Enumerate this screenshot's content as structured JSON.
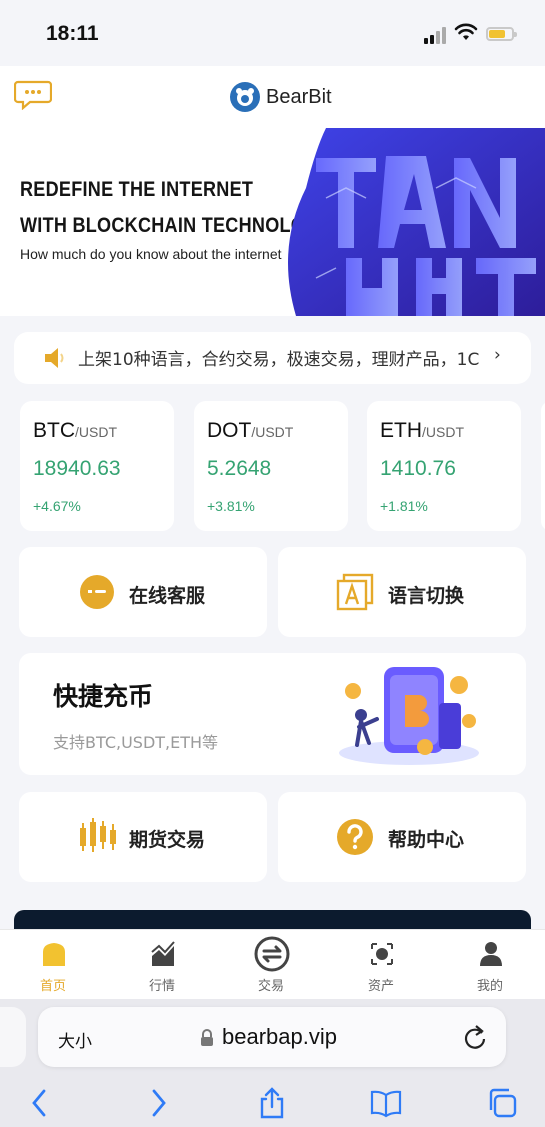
{
  "status_bar": {
    "time": "18:11"
  },
  "header": {
    "brand": "BearBit"
  },
  "banner": {
    "line1": "REDEFINE THE INTERNET",
    "line2": "WITH BLOCKCHAIN TECHNOLOGY",
    "subtitle": "How much do you know about the internet"
  },
  "notice": {
    "text": "上架10种语言，合约交易，极速交易，理财产品，1C",
    "more": "›"
  },
  "tickers": [
    {
      "base": "BTC",
      "quote": "/USDT",
      "price": "18940.63",
      "change": "+4.67%"
    },
    {
      "base": "DOT",
      "quote": "/USDT",
      "price": "5.2648",
      "change": "+3.81%"
    },
    {
      "base": "ETH",
      "quote": "/USDT",
      "price": "1410.76",
      "change": "+1.81%"
    }
  ],
  "quick": {
    "online_service": "在线客服",
    "language_switch": "语言切换",
    "futures": "期货交易",
    "help_center": "帮助中心"
  },
  "recharge": {
    "title": "快捷充币",
    "subtitle": "支持BTC,USDT,ETH等"
  },
  "tabbar": {
    "items": [
      {
        "label": "首页",
        "icon": "home-icon"
      },
      {
        "label": "行情",
        "icon": "market-chart-icon"
      },
      {
        "label": "交易",
        "icon": "exchange-icon"
      },
      {
        "label": "资产",
        "icon": "assets-icon"
      },
      {
        "label": "我的",
        "icon": "profile-icon"
      }
    ]
  },
  "browser": {
    "text_size": "大小",
    "url": "bearbap.vip"
  },
  "colors": {
    "accent": "#e5a92a",
    "positive": "#35a372",
    "background": "#f4f5f9"
  }
}
